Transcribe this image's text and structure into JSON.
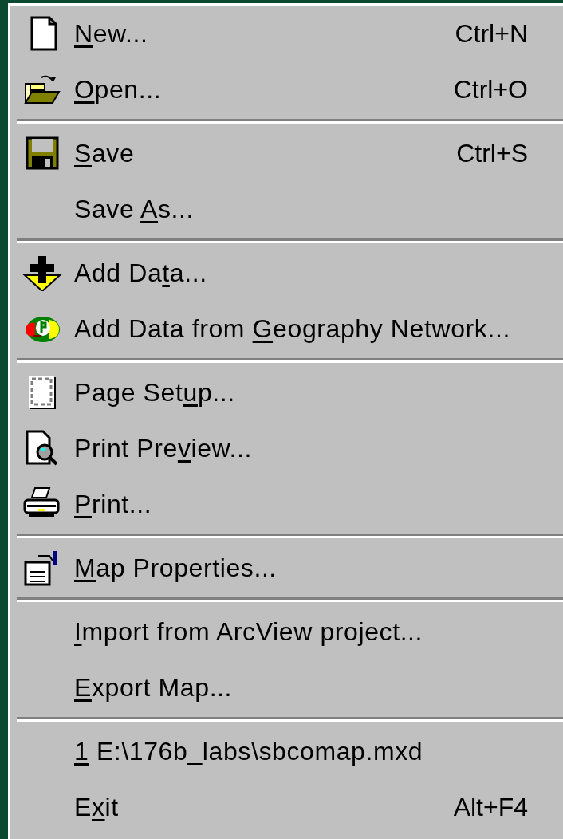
{
  "menu": {
    "entries": [
      {
        "kind": "item",
        "access_key": "N",
        "text_after": "ew...",
        "shortcut": "Ctrl+N"
      },
      {
        "kind": "item",
        "access_key": "O",
        "text_after": "pen...",
        "shortcut": "Ctrl+O"
      },
      {
        "kind": "separator"
      },
      {
        "kind": "item",
        "access_key": "S",
        "text_after": "ave",
        "shortcut": "Ctrl+S"
      },
      {
        "kind": "item",
        "text_before": "Save ",
        "access_key": "A",
        "text_after": "s..."
      },
      {
        "kind": "separator"
      },
      {
        "kind": "item",
        "text_before": "Add Da",
        "access_key": "t",
        "text_after": "a..."
      },
      {
        "kind": "item",
        "text_before": "Add Data from ",
        "access_key": "G",
        "text_after": "eography Network..."
      },
      {
        "kind": "separator"
      },
      {
        "kind": "item",
        "text_before": "Page Set",
        "access_key": "u",
        "text_after": "p..."
      },
      {
        "kind": "item",
        "text_before": "Print Pre",
        "access_key": "v",
        "text_after": "iew..."
      },
      {
        "kind": "item",
        "access_key": "P",
        "text_after": "rint..."
      },
      {
        "kind": "separator"
      },
      {
        "kind": "item",
        "access_key": "M",
        "text_after": "ap Properties..."
      },
      {
        "kind": "separator"
      },
      {
        "kind": "item",
        "access_key": "I",
        "text_after": "mport from ArcView project..."
      },
      {
        "kind": "item",
        "access_key": "E",
        "text_after": "xport Map..."
      },
      {
        "kind": "separator"
      },
      {
        "kind": "item",
        "access_key": "1",
        "text_after": " E:\\176b_labs\\sbcomap.mxd"
      },
      {
        "kind": "item",
        "text_before": "E",
        "access_key": "x",
        "text_after": "it",
        "shortcut": "Alt+F4"
      }
    ]
  }
}
